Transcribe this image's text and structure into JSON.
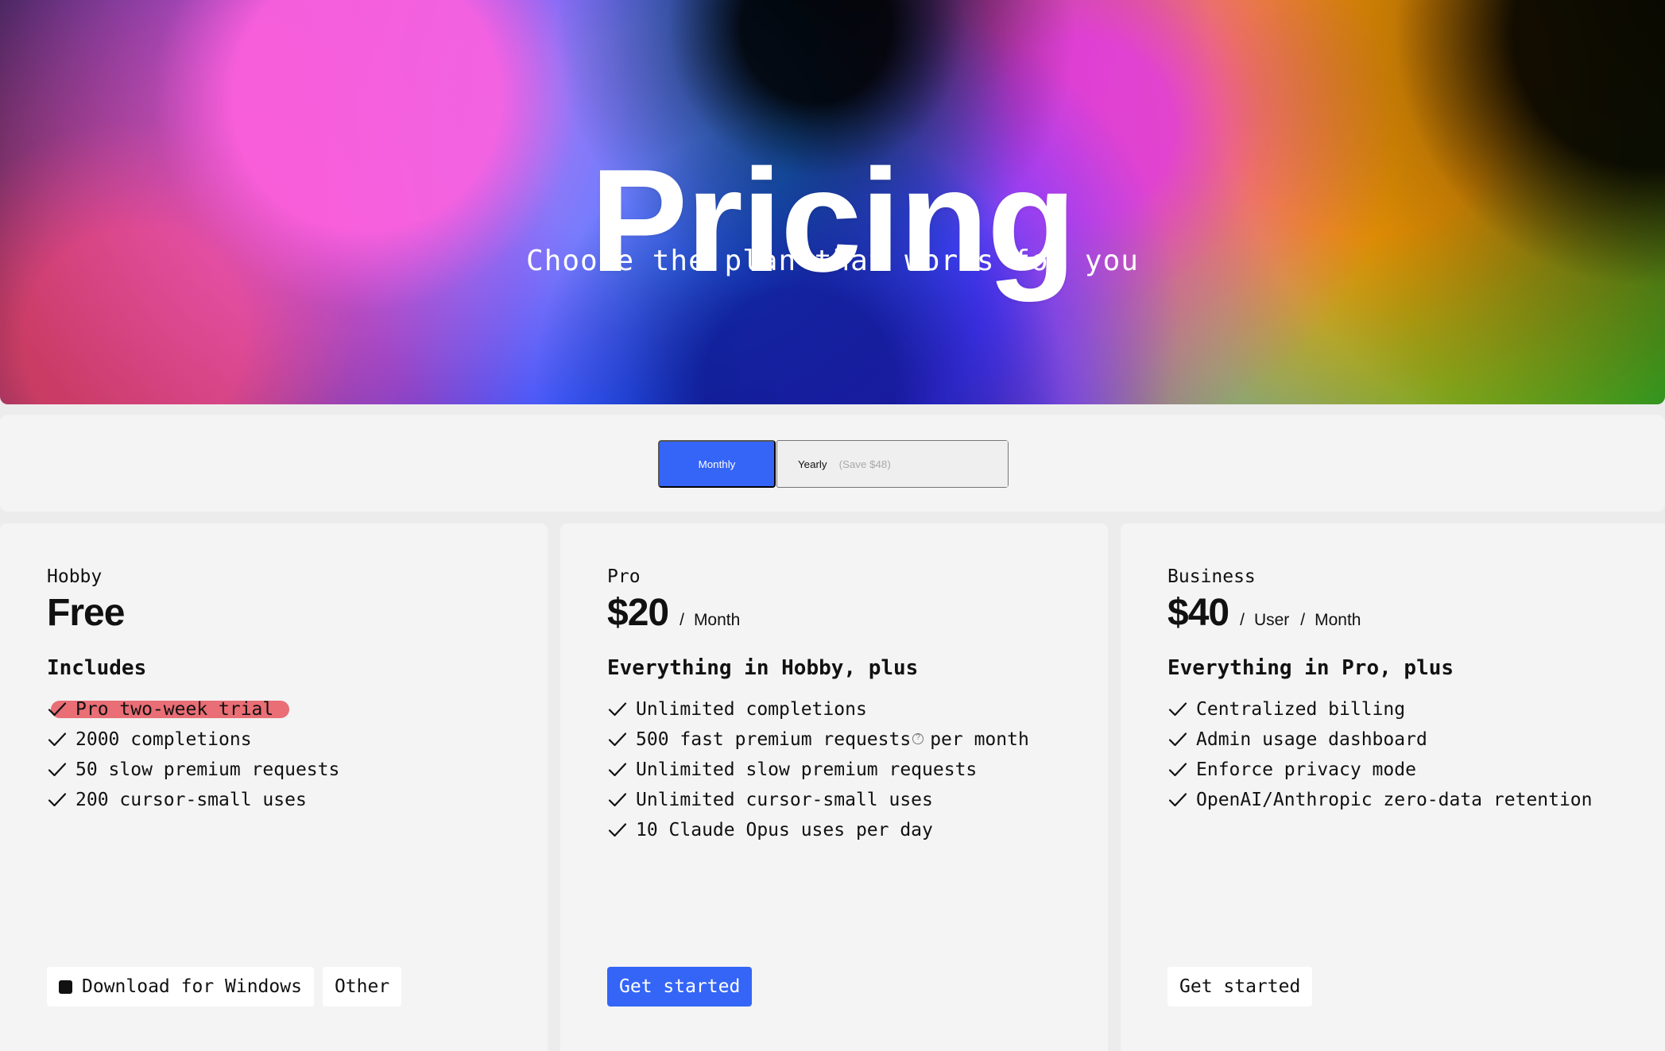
{
  "hero": {
    "title": "Pricing",
    "subtitle": "Choose the plan that works for you"
  },
  "billing_toggle": {
    "monthly_label": "Monthly",
    "yearly_label": "Yearly",
    "yearly_savings": "(Save $48)",
    "selected": "Monthly"
  },
  "plans": [
    {
      "name": "Hobby",
      "price": "Free",
      "includes_heading": "Includes",
      "features": [
        {
          "text": "Pro two-week trial",
          "highlighted": true
        },
        {
          "text": "2000 completions"
        },
        {
          "text": "50 slow premium requests"
        },
        {
          "text": "200 cursor-small uses"
        }
      ],
      "actions": [
        {
          "label": "Download for Windows",
          "icon": "windows-icon"
        },
        {
          "label": "Other"
        }
      ]
    },
    {
      "name": "Pro",
      "price": "$20",
      "price_separator": "/",
      "price_unit": "Month",
      "includes_heading": "Everything in Hobby, plus",
      "features": [
        {
          "text": "Unlimited completions"
        },
        {
          "text_prefix": "500 fast premium requests",
          "text_suffix": "per month",
          "icon": "help-circle-icon"
        },
        {
          "text": "Unlimited slow premium requests"
        },
        {
          "text": "Unlimited cursor-small uses"
        },
        {
          "text": "10 Claude Opus uses per day"
        }
      ],
      "actions": [
        {
          "label": "Get started"
        }
      ]
    },
    {
      "name": "Business",
      "price": "$40",
      "price_separator_1": "/",
      "price_unit_1": "User",
      "price_separator_2": "/",
      "price_unit_2": "Month",
      "includes_heading": "Everything in Pro, plus",
      "features": [
        {
          "text": "Centralized billing"
        },
        {
          "text": "Admin usage dashboard"
        },
        {
          "text": "Enforce privacy mode"
        },
        {
          "text": "OpenAI/Anthropic zero-data retention"
        }
      ],
      "actions": [
        {
          "label": "Get started"
        }
      ]
    }
  ],
  "colors": {
    "accent": "#3465f7",
    "highlight": "#e85f67",
    "panel": "#f4f4f4",
    "text": "#111111"
  }
}
